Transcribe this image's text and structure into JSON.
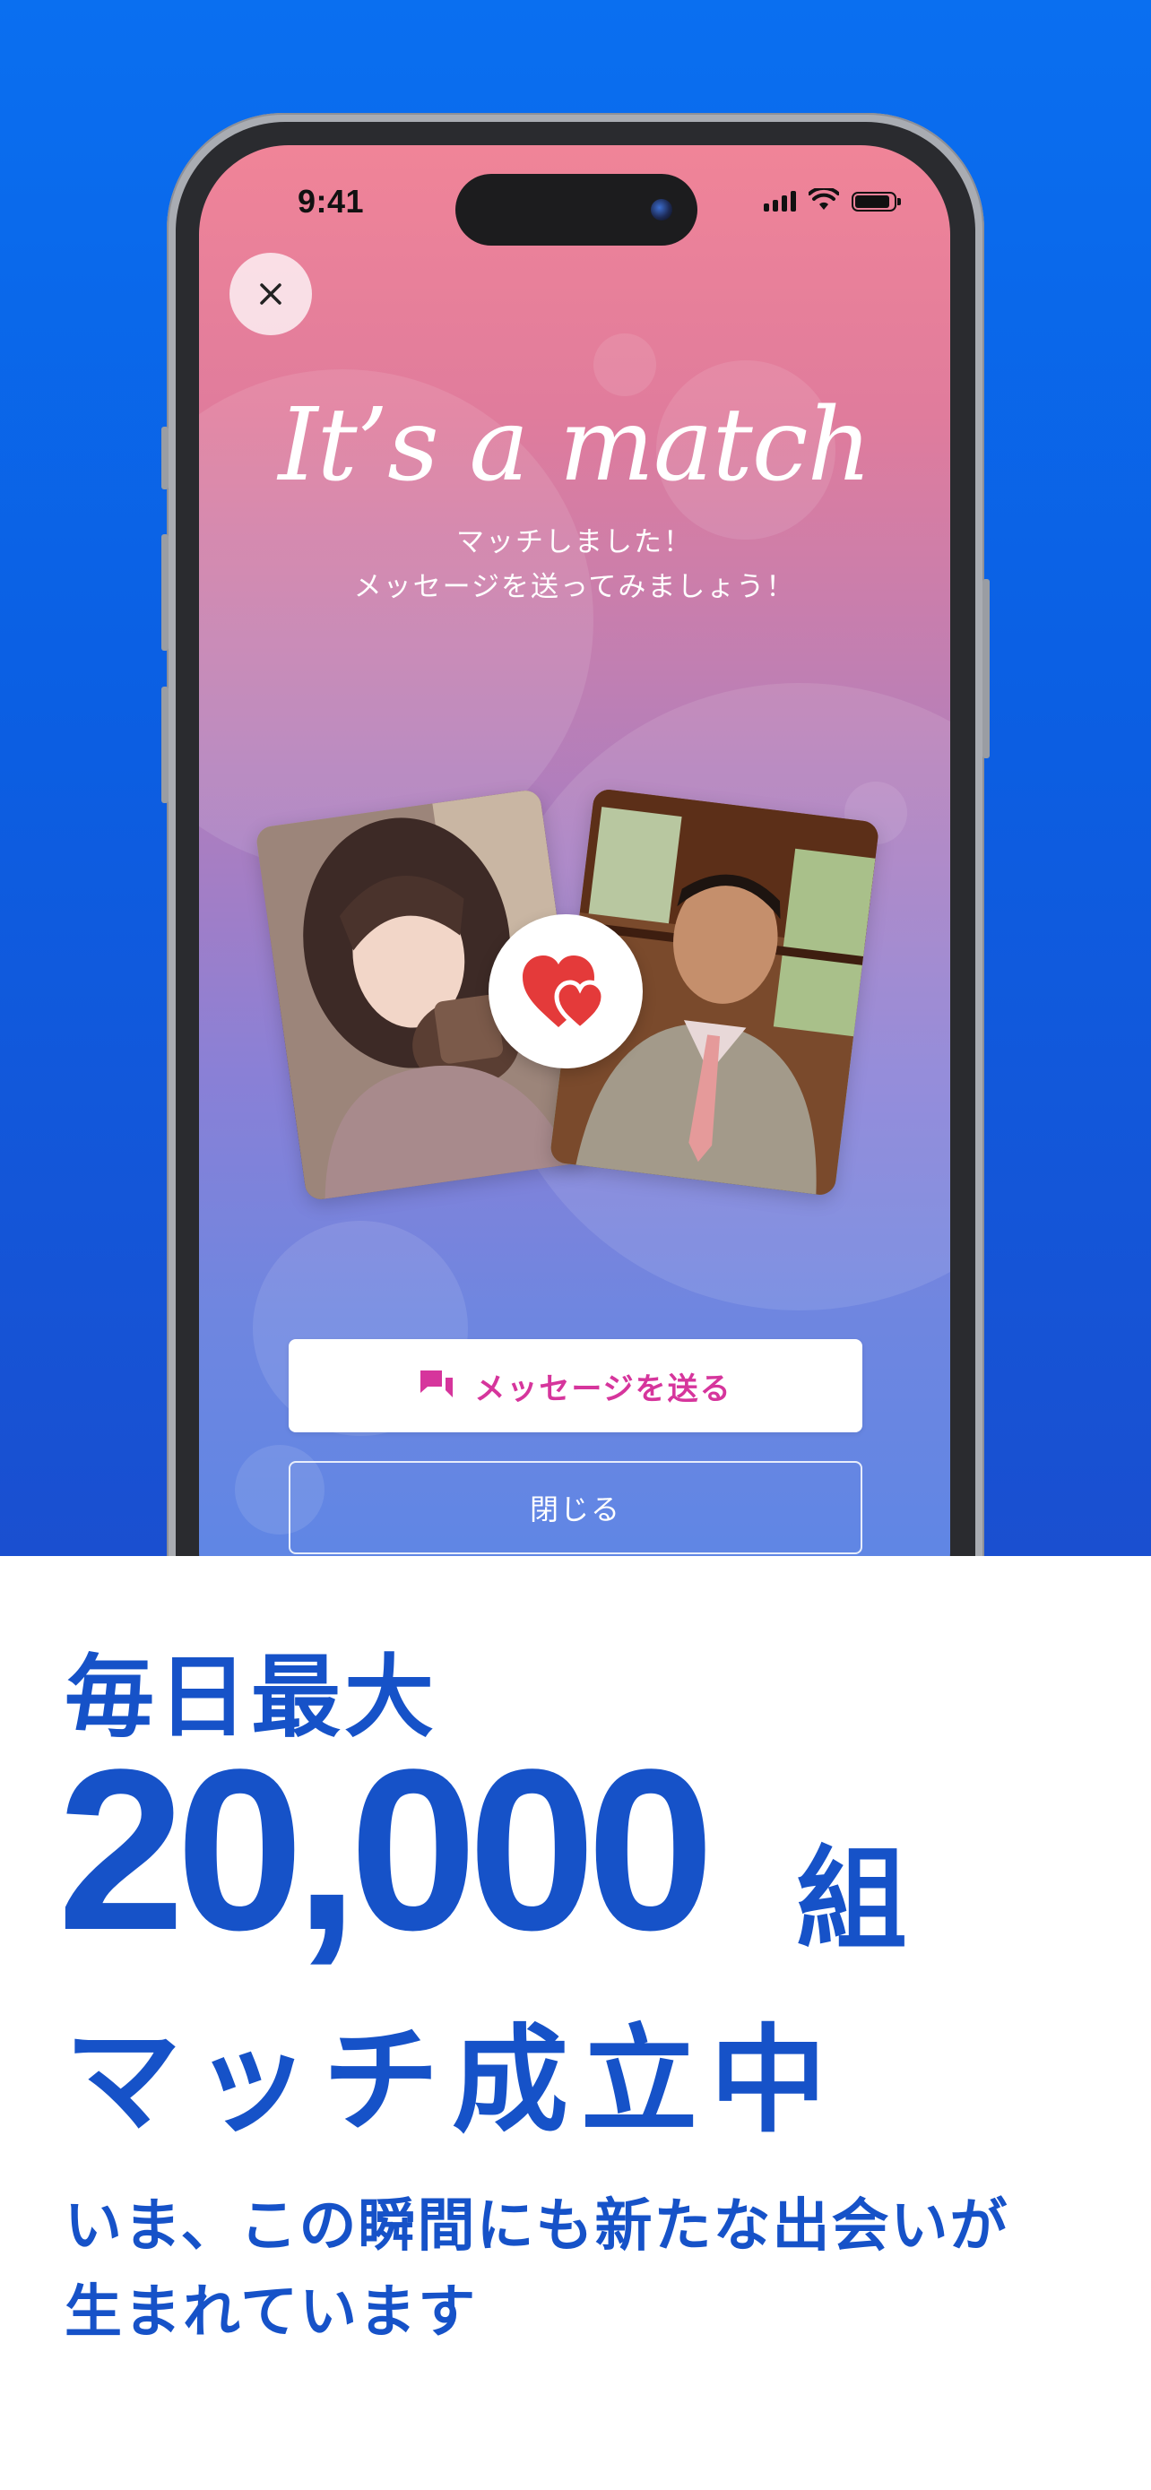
{
  "status_bar": {
    "time": "9:41"
  },
  "match_screen": {
    "headline": "It’s a match",
    "subtitle_line1": "マッチしました！",
    "subtitle_line2": "メッセージを送ってみましょう！",
    "icons": {
      "close": "close-icon",
      "heart": "hearts-icon",
      "message": "chat-icon"
    },
    "send_message_label": "メッセージを送る",
    "close_label": "閉じる",
    "colors": {
      "send_label": "#d6359c"
    }
  },
  "promo": {
    "line1": "毎日最大",
    "number": "20,000",
    "unit": "組",
    "line3": "マッチ成立中",
    "tagline_line1": "いま、この瞬間にも新たな出会いが",
    "tagline_line2": "生まれています",
    "colors": {
      "text": "#1652c8",
      "background_top": "#0a6ff0"
    }
  }
}
